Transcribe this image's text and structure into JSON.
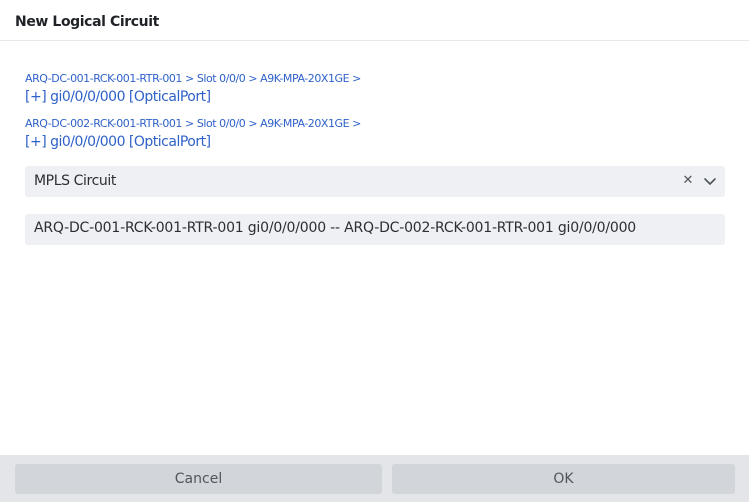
{
  "dialog": {
    "title": "New Logical Circuit"
  },
  "endpoints": [
    {
      "path": "ARQ-DC-001-RCK-001-RTR-001 > Slot 0/0/0 > A9K-MPA-20X1GE >",
      "port": "[+] gi0/0/0/000 [OpticalPort]"
    },
    {
      "path": "ARQ-DC-002-RCK-001-RTR-001 > Slot 0/0/0 > A9K-MPA-20X1GE >",
      "port": "[+] gi0/0/0/000 [OpticalPort]"
    }
  ],
  "circuit_type": {
    "selected": "MPLS Circuit",
    "clear_icon": "close-icon",
    "expand_icon": "chevron-down-icon"
  },
  "circuit_name": {
    "value": "ARQ-DC-001-RCK-001-RTR-001 gi0/0/0/000 -- ARQ-DC-002-RCK-001-RTR-001 gi0/0/0/000"
  },
  "footer": {
    "cancel_label": "Cancel",
    "ok_label": "OK"
  },
  "colors": {
    "link": "#2f62c9",
    "field_bg": "#eef0f3",
    "footer_bg": "#e3e5e8",
    "button_bg": "#d2d5d9"
  }
}
